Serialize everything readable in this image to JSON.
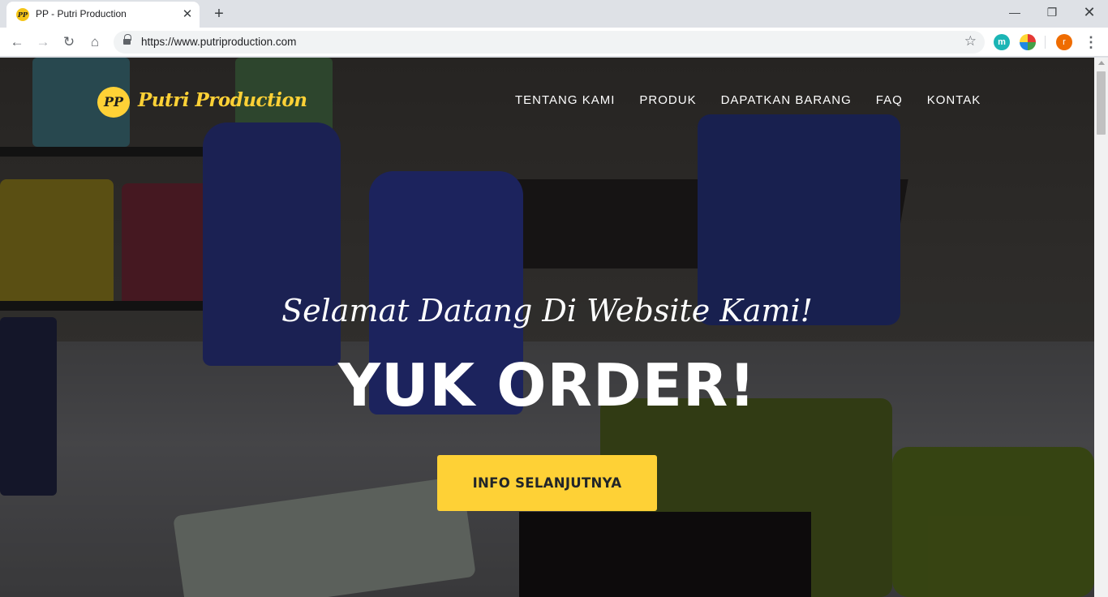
{
  "browser": {
    "tab": {
      "title": "PP - Putri Production",
      "favicon_text": "PP",
      "close_glyph": "✕"
    },
    "new_tab_glyph": "+",
    "window_controls": {
      "minimize": "—",
      "maximize": "❐",
      "close": "✕"
    },
    "toolbar": {
      "back_glyph": "←",
      "forward_glyph": "→",
      "reload_glyph": "↻",
      "home_glyph": "⌂",
      "url": "https://www.putriproduction.com",
      "bookmark_glyph": "☆",
      "menu_glyph": "⋮"
    },
    "extensions": [
      {
        "name": "m-extension-icon",
        "label": "m"
      },
      {
        "name": "globe-extension-icon",
        "label": ""
      }
    ],
    "profile_initial": "r"
  },
  "site": {
    "brand": {
      "logo_text": "PP",
      "name": "Putri Production"
    },
    "nav": [
      "TENTANG KAMI",
      "PRODUK",
      "DAPATKAN BARANG",
      "FAQ",
      "KONTAK"
    ],
    "hero": {
      "subheading": "Selamat Datang Di Website Kami!",
      "heading": "YUK ORDER!",
      "cta_label": "INFO SELANJUTNYA"
    }
  },
  "colors": {
    "accent": "#fed136",
    "hero_text": "#ffffff",
    "chrome_bg": "#dee1e6"
  }
}
